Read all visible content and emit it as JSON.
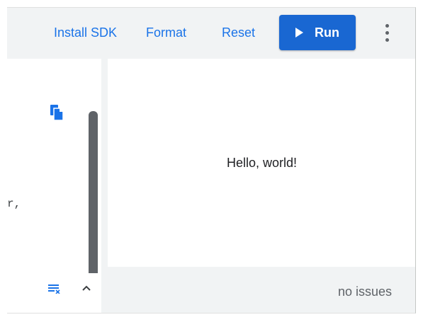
{
  "toolbar": {
    "install_sdk": "Install SDK",
    "format": "Format",
    "reset": "Reset",
    "run": "Run",
    "more_icon": "more-vert-icon"
  },
  "editor": {
    "code_fragment": "r,",
    "copy_icon": "copy-icon"
  },
  "output": {
    "text": "Hello, world!"
  },
  "status": {
    "clear_icon": "clear-console-icon",
    "expand_icon": "chevron-up-icon",
    "issues": "no issues"
  },
  "colors": {
    "accent": "#1a73e8",
    "run_button": "#1967d2",
    "panel_bg": "#f1f3f4",
    "scrollbar": "#5f6368"
  }
}
